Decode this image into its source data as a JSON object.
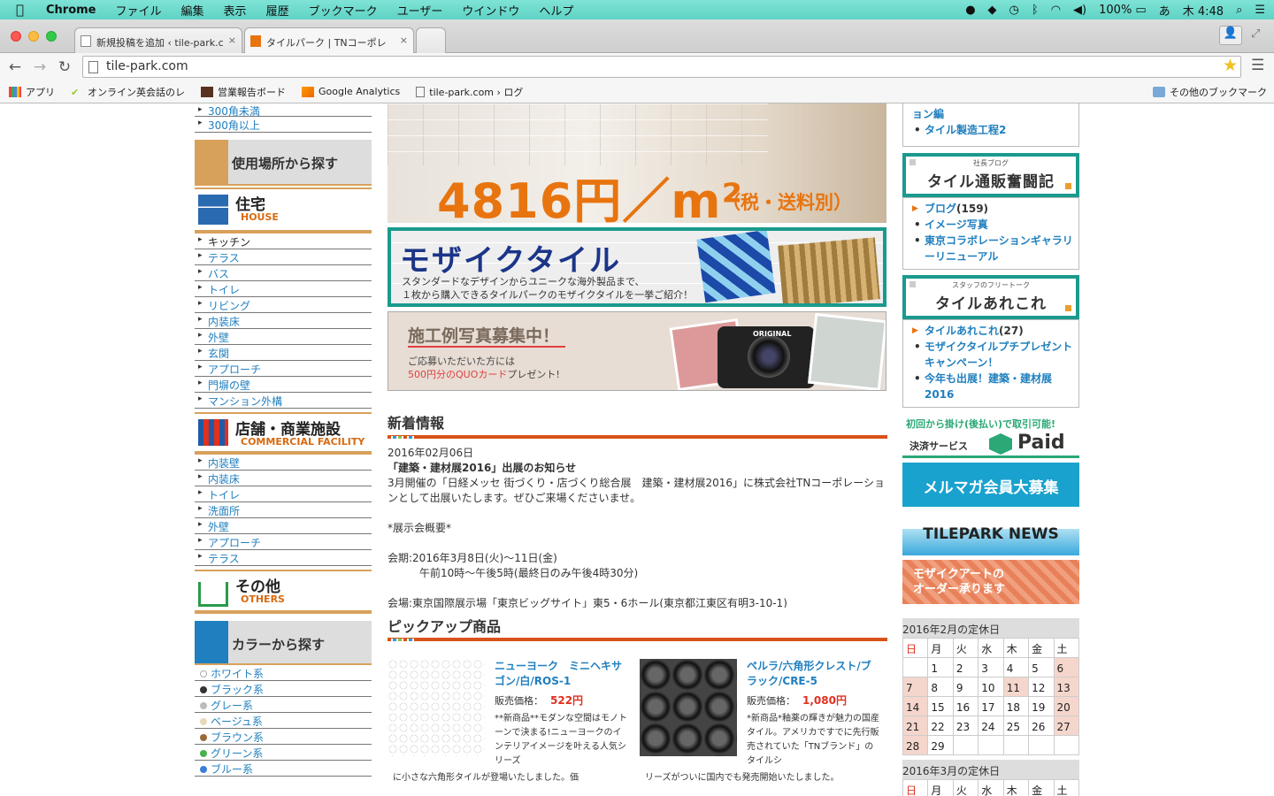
{
  "menubar": {
    "app": "Chrome",
    "items": [
      "ファイル",
      "編集",
      "表示",
      "履歴",
      "ブックマーク",
      "ユーザー",
      "ウインドウ",
      "ヘルプ"
    ],
    "battery": "100%",
    "ime": "あ",
    "clock": "木 4:48"
  },
  "tabs": [
    {
      "title": "新規投稿を追加 ‹ tile-park.c"
    },
    {
      "title": "タイルパーク | TNコーポレ"
    }
  ],
  "address": "tile-park.com",
  "bookmarks": [
    "アプリ",
    "オンライン英会話のレ",
    "営業報告ボード",
    "Google Analytics",
    "tile-park.com › ログ",
    "その他のブックマーク"
  ],
  "left": {
    "size_items": [
      "300角未満",
      "300角以上"
    ],
    "location_heading": "使用場所から探す",
    "house": {
      "jp": "住宅",
      "en": "HOUSE",
      "items": [
        "キッチン",
        "テラス",
        "バス",
        "トイレ",
        "リビング",
        "内装床",
        "外壁",
        "玄関",
        "アプローチ",
        "門塀の壁",
        "マンション外構"
      ]
    },
    "commercial": {
      "jp": "店舗・商業施設",
      "en": "COMMERCIAL FACILITY",
      "items": [
        "内装壁",
        "内装床",
        "トイレ",
        "洗面所",
        "外壁",
        "アプローチ",
        "テラス"
      ]
    },
    "others": {
      "jp": "その他",
      "en": "OTHERS"
    },
    "color_heading": "カラーから探す",
    "colors": [
      {
        "label": "ホワイト系",
        "color": "#ffffff"
      },
      {
        "label": "ブラック系",
        "color": "#333333"
      },
      {
        "label": "グレー系",
        "color": "#bbbbbb"
      },
      {
        "label": "ベージュ系",
        "color": "#e8d8bc"
      },
      {
        "label": "ブラウン系",
        "color": "#9b6a3a"
      },
      {
        "label": "グリーン系",
        "color": "#49b04a"
      },
      {
        "label": "ブルー系",
        "color": "#3a7ed8"
      }
    ]
  },
  "hero": {
    "price": "4816円／m²",
    "tax": "（税・送料別）"
  },
  "mosaic_banner": {
    "title": "モザイクタイル",
    "line1": "スタンダードなデザインからユニークな海外製品まで、",
    "line2": "１枚から購入できるタイルパークのモザイクタイルを一挙ご紹介！"
  },
  "photo_banner": {
    "title": "施工例写真募集中！",
    "line1": "ご応募いただいた方には",
    "line2_red": "500円分のQUOカード",
    "line2_rest": "プレゼント!",
    "camera_label": "ORIGINAL"
  },
  "news": {
    "heading": "新着情報",
    "date": "2016年02月06日",
    "title": "「建築・建材展2016」出展のお知らせ",
    "body1": "3月開催の「日経メッセ 街づくり・店づくり総合展　建築・建材展2016」に株式会社TNコーポレーションとして出展いたします。ぜひご来場くださいませ。",
    "outline": "*展示会概要*",
    "period": "会期:2016年3月8日(火)～11日(金)",
    "hours": "　　　午前10時～午後5時(最終日のみ午後4時30分)",
    "venue": "会場:東京国際展示場「東京ビッグサイト」東5・6ホール(東京都江東区有明3-10-1)"
  },
  "pickup": {
    "heading": "ピックアップ商品",
    "price_label": "販売価格：",
    "products": [
      {
        "name": "ニューヨーク　ミニヘキサゴン/白/ROS-1",
        "price": "522円",
        "desc": "**新商品**モダンな空間はモノトーンで決まる!ニューヨークのインテリアイメージを叶える人気シリーズ",
        "desc2": "に小さな六角形タイルが登場いたしました。価"
      },
      {
        "name": "ペルラ/六角形クレスト/ブラック/CRE-5",
        "price": "1,080円",
        "desc": "*新商品*釉薬の輝きが魅力の国産タイル。アメリカですでに先行販売されていた「TNブランド」のタイルシ",
        "desc2": "リーズがついに国内でも発売開始いたしました。"
      }
    ]
  },
  "right": {
    "top_links": [
      "ョン編",
      "タイル製造工程2"
    ],
    "blog_small": "社長ブログ",
    "blog_big": "タイル通販奮闘記",
    "blog_cat": "ブログ",
    "blog_count": "(159)",
    "blog_items": [
      "イメージ写真",
      "東京コラボレーションギャラリーリニューアル"
    ],
    "staff_small": "スタッフのフリートーク",
    "staff_big": "タイルあれこれ",
    "staff_cat": "タイルあれこれ",
    "staff_count": "(27)",
    "staff_items": [
      "モザイクタイルプチプレゼントキャンペーン！",
      "今年も出展！建築・建材展2016"
    ],
    "paid_line1": "初回から掛け(後払い)で取引可能!",
    "paid_label": "決済サービス",
    "paid_brand": "Paid",
    "mailmag": "メルマガ会員大募集",
    "news_banner": "TILEPARK NEWS",
    "art_line1": "モザイクアートの",
    "art_line2": "オーダー承ります",
    "cal1": {
      "caption": "2016年2月の定休日",
      "weekdays": [
        "日",
        "月",
        "火",
        "水",
        "木",
        "金",
        "土"
      ],
      "rows": [
        [
          "",
          "1",
          "2",
          "3",
          "4",
          "5",
          "6"
        ],
        [
          "7",
          "8",
          "9",
          "10",
          "11",
          "12",
          "13"
        ],
        [
          "14",
          "15",
          "16",
          "17",
          "18",
          "19",
          "20"
        ],
        [
          "21",
          "22",
          "23",
          "24",
          "25",
          "26",
          "27"
        ],
        [
          "28",
          "29",
          "",
          "",
          "",
          "",
          ""
        ]
      ]
    },
    "cal2": {
      "caption": "2016年3月の定休日",
      "weekdays": [
        "日",
        "月",
        "火",
        "水",
        "木",
        "金",
        "土"
      ]
    }
  }
}
